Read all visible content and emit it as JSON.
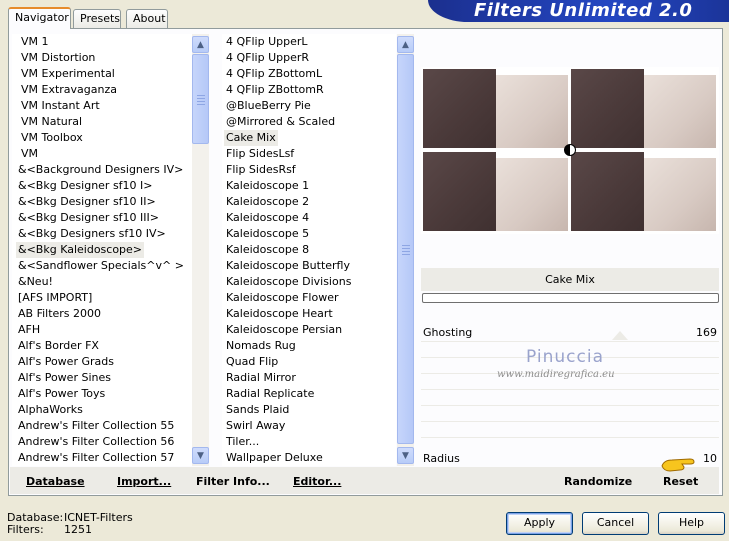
{
  "app": {
    "title": "Filters Unlimited 2.0"
  },
  "tabs": [
    {
      "label": "Navigator",
      "active": true
    },
    {
      "label": "Presets",
      "active": false
    },
    {
      "label": "About",
      "active": false
    }
  ],
  "categories": [
    "VM 1",
    "VM Distortion",
    "VM Experimental",
    "VM Extravaganza",
    "VM Instant Art",
    "VM Natural",
    "VM Toolbox",
    "VM",
    "&<Background Designers IV>",
    "&<Bkg Designer sf10 I>",
    "&<Bkg Designer sf10 II>",
    "&<Bkg Designer sf10 III>",
    "&<Bkg Designers sf10 IV>",
    "&<Bkg Kaleidoscope>",
    "&<Sandflower Specials^v^ >",
    "&Neu!",
    "[AFS IMPORT]",
    "AB Filters 2000",
    "AFH",
    "Alf's Border FX",
    "Alf's Power Grads",
    "Alf's Power Sines",
    "Alf's Power Toys",
    "AlphaWorks",
    "Andrew's Filter Collection 55",
    "Andrew's Filter Collection 56",
    "Andrew's Filter Collection 57"
  ],
  "categories_selected": "&<Bkg Kaleidoscope>",
  "filters": [
    "4 QFlip UpperL",
    "4 QFlip UpperR",
    "4 QFlip ZBottomL",
    "4 QFlip ZBottomR",
    "@BlueBerry Pie",
    "@Mirrored & Scaled",
    "Cake Mix",
    "Flip SidesLsf",
    "Flip SidesRsf",
    "Kaleidoscope 1",
    "Kaleidoscope 2",
    "Kaleidoscope 4",
    "Kaleidoscope 5",
    "Kaleidoscope 8",
    "Kaleidoscope Butterfly",
    "Kaleidoscope Divisions",
    "Kaleidoscope Flower",
    "Kaleidoscope Heart",
    "Kaleidoscope Persian",
    "Nomads Rug",
    "Quad Flip",
    "Radial Mirror",
    "Radial Replicate",
    "Sands Plaid",
    "Swirl Away",
    "Tiler...",
    "Wallpaper Deluxe"
  ],
  "filters_selected": "Cake Mix",
  "preview": {
    "filter_name": "Cake Mix",
    "progress": 0
  },
  "sliders": [
    {
      "label": "Ghosting",
      "value": "169"
    },
    {
      "label": "Radius",
      "value": "10"
    }
  ],
  "watermark": {
    "title": "Pinuccia",
    "url": "www.maidiregrafica.eu"
  },
  "toolbar": {
    "database": "Database",
    "import": "Import...",
    "filter_info": "Filter Info...",
    "editor": "Editor...",
    "randomize": "Randomize",
    "reset": "Reset"
  },
  "status": {
    "database_label": "Database:",
    "database_value": "ICNET-Filters",
    "filters_label": "Filters:",
    "filters_value": "1251"
  },
  "buttons": {
    "apply": "Apply",
    "cancel": "Cancel",
    "help": "Help"
  },
  "colors": {
    "banner": "#2447c2",
    "tile_dark": "#4b3a3a",
    "tile_light": "#d8cac3",
    "tab_accent": "#e68b2c"
  }
}
